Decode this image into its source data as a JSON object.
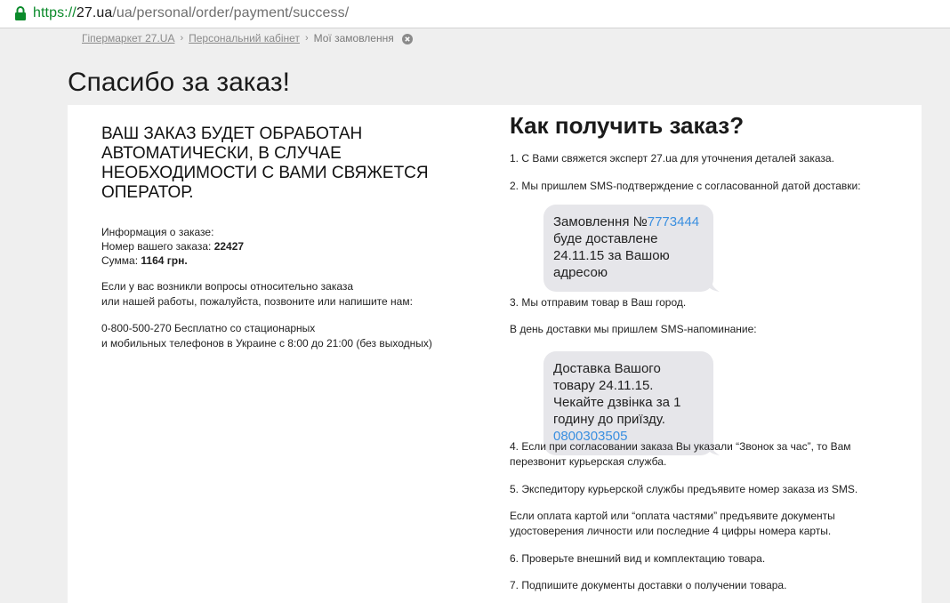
{
  "browser": {
    "url_scheme": "https://",
    "url_host": "27.ua",
    "url_path": "/ua/personal/order/payment/success/"
  },
  "breadcrumb": {
    "items": [
      "Гіпермаркет 27.UA",
      "Персональний кабінет"
    ],
    "separator": "›",
    "current": "Мої замовлення"
  },
  "page_title": "Спасибо за заказ!",
  "left": {
    "headline": "ВАШ ЗАКАЗ БУДЕТ ОБРАБОТАН АВТОМАТИЧЕСКИ, В СЛУЧАЕ НЕОБХОДИМОСТИ С ВАМИ СВЯЖЕТСЯ ОПЕРАТОР.",
    "info_label": "Информация о заказе:",
    "order_label": "Номер вашего заказа:",
    "order_number": "22427",
    "sum_label": "Сумма:",
    "sum_value": "1164 грн.",
    "questions_line1": "Если у вас возникли вопросы относительно заказа",
    "questions_line2": "или нашей работы, пожалуйста, позвоните или напишите нам:",
    "phone_line1": "0-800-500-270 Бесплатно со стационарных",
    "phone_line2": "и мобильных телефонов в Украине с 8:00 до 21:00 (без выходных)"
  },
  "right": {
    "title": "Как получить заказ?",
    "step1": "1. С Вами свяжется эксперт 27.ua для уточнения деталей заказа.",
    "step2": "2. Мы пришлем SMS-подтверждение с согласованной датой доставки:",
    "sms1": {
      "prefix": "Замовлення №",
      "number": "7773444",
      "rest": "буде доставлене 24.11.15 за Вашою адресою"
    },
    "step3": "3. Мы отправим товар в Ваш город.",
    "reminder": "В день доставки мы пришлем SMS-напоминание:",
    "sms2": {
      "text": "Доставка Вашого товару 24.11.15. Чекайте дзвінка за 1 годину до приїзду.",
      "phone": "0800303505"
    },
    "step4_line1": "4. Если при согласовании заказа Вы указали “Звонок за час”, то Вам",
    "step4_line2": "перезвонит курьерская служба.",
    "step5": "5. Экспедитору курьерской службы предъявите номер заказа из SMS.",
    "card_note_line1": "Если оплата картой или “оплата частями” предъявите документы",
    "card_note_line2": "удостоверения личности или последние 4 цифры номера карты.",
    "step6": "6. Проверьте внешний вид и комплектацию товара.",
    "step7": "7. Подпишите документы доставки о получении товара."
  },
  "colors": {
    "secure_green": "#0a8a2a",
    "link_blue": "#3a8fe0",
    "bubble_gray": "#e6e6ea"
  },
  "icons": [
    "lock-icon",
    "close-icon"
  ]
}
